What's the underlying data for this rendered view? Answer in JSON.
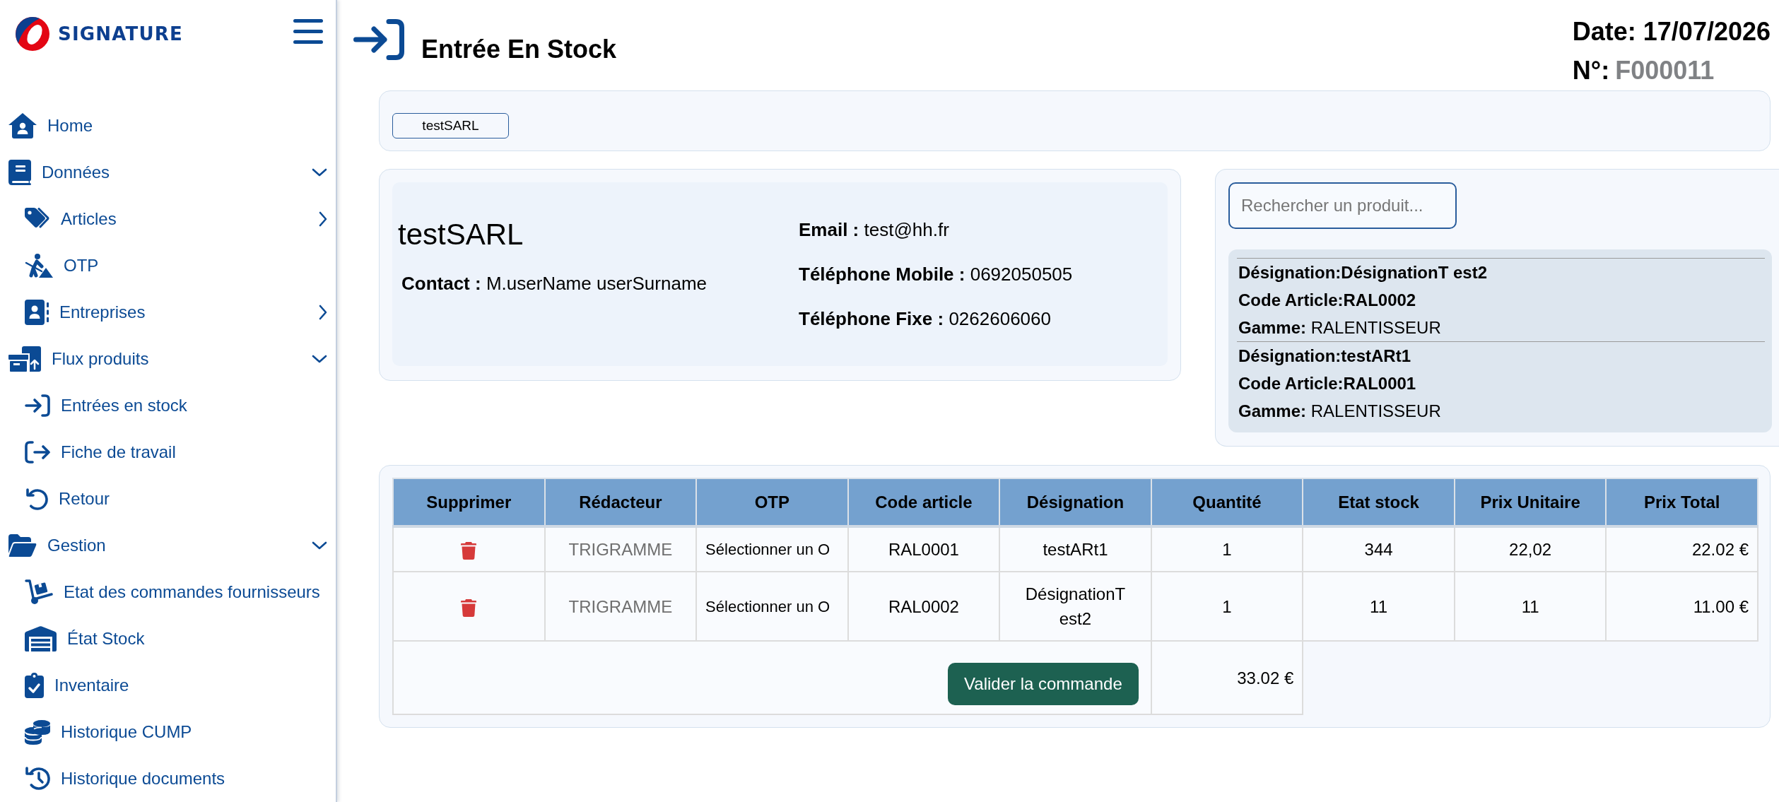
{
  "sidebar": {
    "logo": "SIGNATURE",
    "items": [
      {
        "label": "Home"
      },
      {
        "label": "Données",
        "expanded": true,
        "children": [
          {
            "label": "Articles",
            "expanded": false
          },
          {
            "label": "OTP"
          },
          {
            "label": "Entreprises",
            "expanded": false
          }
        ]
      },
      {
        "label": "Flux produits",
        "expanded": true,
        "children": [
          {
            "label": "Entrées en stock"
          },
          {
            "label": "Fiche de travail"
          },
          {
            "label": "Retour"
          }
        ]
      },
      {
        "label": "Gestion",
        "expanded": true,
        "children": [
          {
            "label": "Etat des commandes fournisseurs"
          },
          {
            "label": "État Stock"
          },
          {
            "label": "Inventaire"
          },
          {
            "label": "Historique CUMP"
          },
          {
            "label": "Historique documents"
          }
        ]
      }
    ]
  },
  "header": {
    "title": "Entrée En Stock",
    "date": "Date: 17/07/2026",
    "number_label": "N°:",
    "number": "F000011"
  },
  "client_bar": {
    "clients": [
      "testSARL"
    ]
  },
  "client": {
    "name": "testSARL",
    "contact": "**Contact :** M.userName userSurname",
    "details": [
      "**Email :** test@hh.fr",
      "**Téléphone Mobile :** 0692050505",
      "**Téléphone Fixe :** 0262606060"
    ]
  },
  "product_search": {
    "placeholder": "Rechercher un produit...",
    "results": [
      {
        "designation": "Désignation:DésignationT est2",
        "code": "Code Article:RAL0002",
        "gamme": "**Gamme:** RALENTISSEUR"
      },
      {
        "designation": "Désignation:testARt1",
        "code": "Code Article:RAL0001",
        "gamme": "**Gamme:** RALENTISSEUR"
      }
    ]
  },
  "order_table": {
    "columns": [
      "Supprimer",
      "Rédacteur",
      "OTP",
      "Code article",
      "Désignation",
      "Quantité",
      "Etat stock",
      "Prix Unitaire",
      "Prix Total"
    ],
    "rows": [
      {
        "redacteur_placeholder": "TRIGRAMME",
        "otp": "Sélectionner un O",
        "code": "RAL0001",
        "designation": "testARt1",
        "quantity": "1",
        "stock": "344",
        "unit_price": "22,02",
        "total": "22.02 €"
      },
      {
        "redacteur_placeholder": "TRIGRAMME",
        "otp": "Sélectionner un O",
        "code": "RAL0002",
        "designation": "DésignationT est2",
        "quantity": "1",
        "stock": "11",
        "unit_price": "11",
        "total": "11.00 €"
      }
    ],
    "submit_button": "Valider la commande",
    "grand_total": "33.02 €"
  }
}
